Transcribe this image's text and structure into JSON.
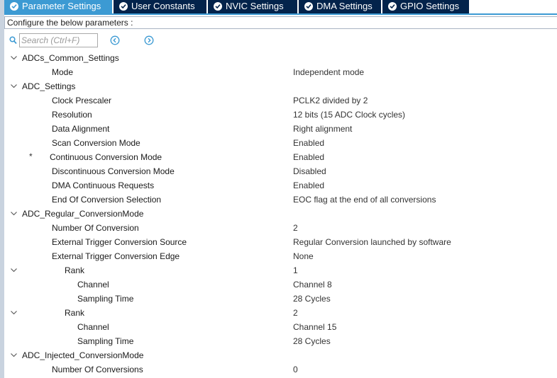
{
  "tabs": [
    {
      "label": "Parameter Settings",
      "active": true
    },
    {
      "label": "User Constants",
      "active": false
    },
    {
      "label": "NVIC Settings",
      "active": false
    },
    {
      "label": "DMA Settings",
      "active": false
    },
    {
      "label": "GPIO Settings",
      "active": false
    }
  ],
  "instruction": "Configure the below parameters :",
  "search": {
    "placeholder": "Search (Ctrl+F)"
  },
  "colors": {
    "tab_active": "#3c9ad3",
    "tab_inactive": "#03234b",
    "nav_icon": "#3c9ad3"
  },
  "tree": [
    {
      "name": "ADCs_Common_Settings",
      "value": "",
      "level": 0,
      "expandable": true
    },
    {
      "name": "Mode",
      "value": "Independent mode",
      "level": 1
    },
    {
      "name": "ADC_Settings",
      "value": "",
      "level": 0,
      "expandable": true
    },
    {
      "name": "Clock Prescaler",
      "value": "PCLK2 divided by 2",
      "level": 1
    },
    {
      "name": "Resolution",
      "value": "12 bits (15 ADC Clock cycles)",
      "level": 1
    },
    {
      "name": "Data Alignment",
      "value": "Right alignment",
      "level": 1
    },
    {
      "name": "Scan Conversion Mode",
      "value": "Enabled",
      "level": 1
    },
    {
      "name": "Continuous Conversion Mode",
      "value": "Enabled",
      "level": 1,
      "modified": true,
      "marker": "*"
    },
    {
      "name": "Discontinuous Conversion Mode",
      "value": "Disabled",
      "level": 1
    },
    {
      "name": "DMA Continuous Requests",
      "value": "Enabled",
      "level": 1
    },
    {
      "name": "End Of Conversion Selection",
      "value": "EOC flag at the end of all conversions",
      "level": 1
    },
    {
      "name": "ADC_Regular_ConversionMode",
      "value": "",
      "level": 0,
      "expandable": true
    },
    {
      "name": "Number Of Conversion",
      "value": "2",
      "level": 1
    },
    {
      "name": "External Trigger Conversion Source",
      "value": "Regular Conversion launched by software",
      "level": 1
    },
    {
      "name": "External Trigger Conversion Edge",
      "value": "None",
      "level": 1
    },
    {
      "name": "Rank",
      "value": "1",
      "level": 2,
      "expandable": true
    },
    {
      "name": "Channel",
      "value": "Channel 8",
      "level": 3
    },
    {
      "name": "Sampling Time",
      "value": "28 Cycles",
      "level": 3
    },
    {
      "name": "Rank",
      "value": "2",
      "level": 2,
      "expandable": true
    },
    {
      "name": "Channel",
      "value": "Channel 15",
      "level": 3
    },
    {
      "name": "Sampling Time",
      "value": "28 Cycles",
      "level": 3
    },
    {
      "name": "ADC_Injected_ConversionMode",
      "value": "",
      "level": 0,
      "expandable": true
    },
    {
      "name": "Number Of Conversions",
      "value": "0",
      "level": 1
    }
  ]
}
